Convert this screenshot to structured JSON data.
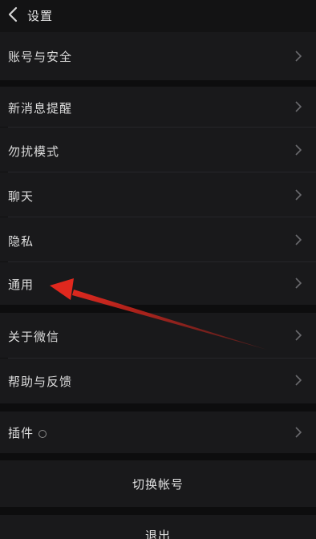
{
  "header": {
    "title": "设置",
    "back_icon": "chevron-left-icon"
  },
  "menu": {
    "account_security": "账号与安全",
    "new_message_alert": "新消息提醒",
    "do_not_disturb": "勿扰模式",
    "chat": "聊天",
    "privacy": "隐私",
    "general": "通用",
    "about_wechat": "关于微信",
    "help_feedback": "帮助与反馈",
    "plugins": "插件"
  },
  "actions": {
    "switch_account": "切换帐号",
    "logout": "退出"
  },
  "annotation": {
    "arrow_color": "#e0281e",
    "icon": "red-arrow-pointer"
  }
}
